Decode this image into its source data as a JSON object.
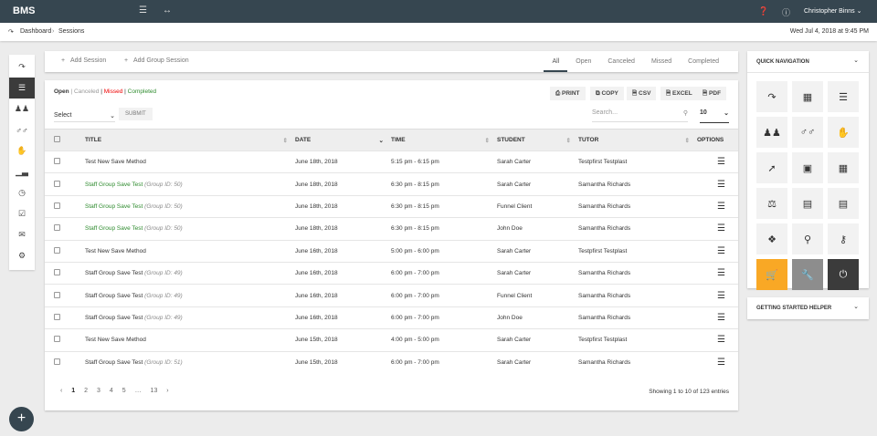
{
  "header": {
    "brand": "BMS",
    "user": "Christopher Binns"
  },
  "breadcrumb": {
    "home": "Dashboard",
    "current": "Sessions",
    "datetime": "Wed Jul 4, 2018 at 9:45 PM"
  },
  "actions": {
    "add_session": "Add Session",
    "add_group": "Add Group Session"
  },
  "tabs": [
    "All",
    "Open",
    "Canceled",
    "Missed",
    "Completed"
  ],
  "legend": {
    "open": "Open",
    "canceled": "Canceled",
    "missed": "Missed",
    "completed": "Completed",
    "sep": "|"
  },
  "bulk": {
    "select": "Select",
    "submit": "SUBMIT"
  },
  "export": [
    "PRINT",
    "COPY",
    "CSV",
    "EXCEL",
    "PDF"
  ],
  "search": {
    "placeholder": "Search..."
  },
  "page_size": "10",
  "columns": [
    "TITLE",
    "DATE",
    "TIME",
    "STUDENT",
    "TUTOR",
    "OPTIONS"
  ],
  "rows": [
    {
      "title": "Test New Save Method",
      "group": "",
      "date": "June 18th, 2018",
      "time": "5:15 pm - 6:15 pm",
      "student": "Sarah Carter",
      "tutor": "Testpfirst Testplast",
      "color": "#333"
    },
    {
      "title": "Staff Group Save Test",
      "group": "(Group ID: 50)",
      "date": "June 18th, 2018",
      "time": "6:30 pm - 8:15 pm",
      "student": "Sarah Carter",
      "tutor": "Samantha Richards",
      "color": "#2e8b2e"
    },
    {
      "title": "Staff Group Save Test",
      "group": "(Group ID: 50)",
      "date": "June 18th, 2018",
      "time": "6:30 pm - 8:15 pm",
      "student": "Funnel Client",
      "tutor": "Samantha Richards",
      "color": "#2e8b2e"
    },
    {
      "title": "Staff Group Save Test",
      "group": "(Group ID: 50)",
      "date": "June 18th, 2018",
      "time": "6:30 pm - 8:15 pm",
      "student": "John Doe",
      "tutor": "Samantha Richards",
      "color": "#2e8b2e"
    },
    {
      "title": "Test New Save Method",
      "group": "",
      "date": "June 16th, 2018",
      "time": "5:00 pm - 6:00 pm",
      "student": "Sarah Carter",
      "tutor": "Testpfirst Testplast",
      "color": "#333"
    },
    {
      "title": "Staff Group Save Test",
      "group": "(Group ID: 49)",
      "date": "June 16th, 2018",
      "time": "6:00 pm - 7:00 pm",
      "student": "Sarah Carter",
      "tutor": "Samantha Richards",
      "color": "#333"
    },
    {
      "title": "Staff Group Save Test",
      "group": "(Group ID: 49)",
      "date": "June 16th, 2018",
      "time": "6:00 pm - 7:00 pm",
      "student": "Funnel Client",
      "tutor": "Samantha Richards",
      "color": "#333"
    },
    {
      "title": "Staff Group Save Test",
      "group": "(Group ID: 49)",
      "date": "June 16th, 2018",
      "time": "6:00 pm - 7:00 pm",
      "student": "John Doe",
      "tutor": "Samantha Richards",
      "color": "#333"
    },
    {
      "title": "Test New Save Method",
      "group": "",
      "date": "June 15th, 2018",
      "time": "4:00 pm - 5:00 pm",
      "student": "Sarah Carter",
      "tutor": "Testpfirst Testplast",
      "color": "#333"
    },
    {
      "title": "Staff Group Save Test",
      "group": "(Group ID: 51)",
      "date": "June 15th, 2018",
      "time": "6:00 pm - 7:00 pm",
      "student": "Sarah Carter",
      "tutor": "Samantha Richards",
      "color": "#333"
    }
  ],
  "pagination": {
    "pages": [
      "1",
      "2",
      "3",
      "4",
      "5",
      "…",
      "13"
    ],
    "info": "Showing 1 to 10 of 123 entries"
  },
  "quick_nav": {
    "title": "QUICK NAVIGATION",
    "helper": "GETTING STARTED HELPER"
  }
}
